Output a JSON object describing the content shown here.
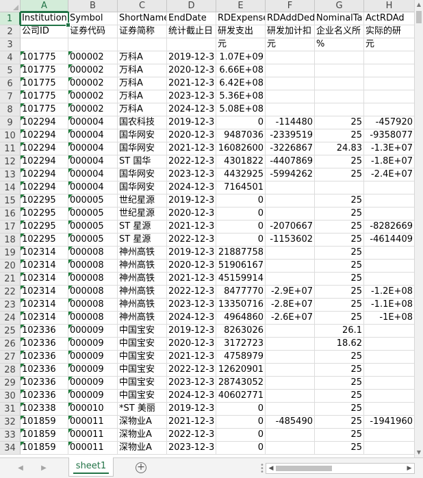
{
  "columns": [
    "A",
    "B",
    "C",
    "D",
    "E",
    "F",
    "G",
    "H"
  ],
  "selected_column": "A",
  "selected_row": "1",
  "sheet_tab": "sheet1",
  "icons": {
    "add_sheet": "plus-circle-icon",
    "nav_prev": "triangle-left-icon",
    "nav_next": "triangle-right-icon"
  },
  "accent_color": "#217346",
  "rows": [
    {
      "n": "1",
      "cells": [
        "InstitutionI",
        "Symbol",
        "ShortName",
        "EndDate",
        "RDExpenses",
        "RDAddDed",
        "NominalTa",
        "ActRDAd"
      ]
    },
    {
      "n": "2",
      "cells": [
        "公司ID",
        "证券代码",
        "证券简称",
        "统计截止日",
        "研发支出",
        "研发加计扣",
        "企业名义所",
        "实际的研"
      ]
    },
    {
      "n": "3",
      "cells": [
        "",
        "",
        "",
        "",
        "元",
        "元",
        "%",
        "元"
      ]
    },
    {
      "n": "4",
      "cells": [
        "101775",
        "000002",
        "万科A",
        "2019-12-3",
        "1.07E+09",
        "",
        "",
        ""
      ]
    },
    {
      "n": "5",
      "cells": [
        "101775",
        "000002",
        "万科A",
        "2020-12-3",
        "6.66E+08",
        "",
        "",
        ""
      ]
    },
    {
      "n": "6",
      "cells": [
        "101775",
        "000002",
        "万科A",
        "2021-12-3",
        "6.42E+08",
        "",
        "",
        ""
      ]
    },
    {
      "n": "7",
      "cells": [
        "101775",
        "000002",
        "万科A",
        "2023-12-3",
        "5.36E+08",
        "",
        "",
        ""
      ]
    },
    {
      "n": "8",
      "cells": [
        "101775",
        "000002",
        "万科A",
        "2024-12-3",
        "5.08E+08",
        "",
        "",
        ""
      ]
    },
    {
      "n": "9",
      "cells": [
        "102294",
        "000004",
        "国农科技",
        "2019-12-3",
        "0",
        "-114480",
        "25",
        "-457920"
      ]
    },
    {
      "n": "10",
      "cells": [
        "102294",
        "000004",
        "国华网安",
        "2020-12-3",
        "9487036",
        "-2339519",
        "25",
        "-9358077"
      ]
    },
    {
      "n": "11",
      "cells": [
        "102294",
        "000004",
        "国华网安",
        "2021-12-3",
        "16082600",
        "-3226867",
        "24.83",
        "-1.3E+07"
      ]
    },
    {
      "n": "12",
      "cells": [
        "102294",
        "000004",
        "ST 国华",
        "2022-12-3",
        "4301822",
        "-4407869",
        "25",
        "-1.8E+07"
      ]
    },
    {
      "n": "13",
      "cells": [
        "102294",
        "000004",
        "国华网安",
        "2023-12-3",
        "4432925",
        "-5994262",
        "25",
        "-2.4E+07"
      ]
    },
    {
      "n": "14",
      "cells": [
        "102294",
        "000004",
        "国华网安",
        "2024-12-3",
        "7164501",
        "",
        "",
        ""
      ]
    },
    {
      "n": "15",
      "cells": [
        "102295",
        "000005",
        "世纪星源",
        "2019-12-3",
        "0",
        "",
        "25",
        ""
      ]
    },
    {
      "n": "16",
      "cells": [
        "102295",
        "000005",
        "世纪星源",
        "2020-12-3",
        "0",
        "",
        "25",
        ""
      ]
    },
    {
      "n": "17",
      "cells": [
        "102295",
        "000005",
        "ST 星源",
        "2021-12-3",
        "0",
        "-2070667",
        "25",
        "-8282669"
      ]
    },
    {
      "n": "18",
      "cells": [
        "102295",
        "000005",
        "ST 星源",
        "2022-12-3",
        "0",
        "-1153602",
        "25",
        "-4614409"
      ]
    },
    {
      "n": "19",
      "cells": [
        "102314",
        "000008",
        "神州高铁",
        "2019-12-3",
        "21887758",
        "",
        "25",
        ""
      ]
    },
    {
      "n": "20",
      "cells": [
        "102314",
        "000008",
        "神州高铁",
        "2020-12-3",
        "51906167",
        "",
        "25",
        ""
      ]
    },
    {
      "n": "21",
      "cells": [
        "102314",
        "000008",
        "神州高铁",
        "2021-12-3",
        "45159914",
        "",
        "25",
        ""
      ]
    },
    {
      "n": "22",
      "cells": [
        "102314",
        "000008",
        "神州高铁",
        "2022-12-3",
        "8477770",
        "-2.9E+07",
        "25",
        "-1.2E+08"
      ]
    },
    {
      "n": "23",
      "cells": [
        "102314",
        "000008",
        "神州高铁",
        "2023-12-3",
        "13350716",
        "-2.8E+07",
        "25",
        "-1.1E+08"
      ]
    },
    {
      "n": "24",
      "cells": [
        "102314",
        "000008",
        "神州高铁",
        "2024-12-3",
        "4964860",
        "-2.6E+07",
        "25",
        "-1E+08"
      ]
    },
    {
      "n": "25",
      "cells": [
        "102336",
        "000009",
        "中国宝安",
        "2019-12-3",
        "8263026",
        "",
        "26.1",
        ""
      ]
    },
    {
      "n": "26",
      "cells": [
        "102336",
        "000009",
        "中国宝安",
        "2020-12-3",
        "3172723",
        "",
        "18.62",
        ""
      ]
    },
    {
      "n": "27",
      "cells": [
        "102336",
        "000009",
        "中国宝安",
        "2021-12-3",
        "4758979",
        "",
        "25",
        ""
      ]
    },
    {
      "n": "28",
      "cells": [
        "102336",
        "000009",
        "中国宝安",
        "2022-12-3",
        "12620901",
        "",
        "25",
        ""
      ]
    },
    {
      "n": "29",
      "cells": [
        "102336",
        "000009",
        "中国宝安",
        "2023-12-3",
        "28743052",
        "",
        "25",
        ""
      ]
    },
    {
      "n": "30",
      "cells": [
        "102336",
        "000009",
        "中国宝安",
        "2024-12-3",
        "40602771",
        "",
        "25",
        ""
      ]
    },
    {
      "n": "31",
      "cells": [
        "102338",
        "000010",
        "*ST 美丽",
        "2019-12-3",
        "0",
        "",
        "25",
        ""
      ]
    },
    {
      "n": "32",
      "cells": [
        "101859",
        "000011",
        "深物业A",
        "2021-12-3",
        "0",
        "-485490",
        "25",
        "-1941960"
      ]
    },
    {
      "n": "33",
      "cells": [
        "101859",
        "000011",
        "深物业A",
        "2022-12-3",
        "0",
        "",
        "25",
        ""
      ]
    },
    {
      "n": "34",
      "cells": [
        "101859",
        "000011",
        "深物业A",
        "2023-12-3",
        "0",
        "",
        "25",
        ""
      ]
    }
  ]
}
